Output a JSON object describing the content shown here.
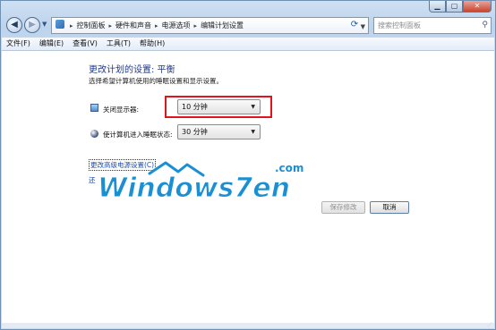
{
  "window": {
    "caption_buttons": {
      "minimize": "▁",
      "maximize": "▢",
      "close": "✕"
    }
  },
  "address_bar": {
    "icon": "control-panel-icon",
    "crumbs": [
      "控制面板",
      "硬件和声音",
      "电源选项",
      "编辑计划设置"
    ],
    "search_placeholder": "搜索控制面板"
  },
  "menu": {
    "items": [
      "文件(F)",
      "编辑(E)",
      "查看(V)",
      "工具(T)",
      "帮助(H)"
    ]
  },
  "content": {
    "title": "更改计划的设置: 平衡",
    "subtitle": "选择希望计算机使用的睡眠设置和显示设置。",
    "display_label": "关闭显示器:",
    "display_value": "10 分钟",
    "sleep_label": "使计算机进入睡眠状态:",
    "sleep_value": "30 分钟",
    "advanced_link": "更改高级电源设置(C)",
    "restore_link": "还",
    "save_button": "保存修改",
    "cancel_button": "取消"
  },
  "watermark": {
    "text": "Windows7en",
    "domain": ".com"
  },
  "colors": {
    "title": "#1e3a8c",
    "link": "#1a4fb1",
    "highlight": "#e0141a",
    "watermark": "#1b8fd4"
  }
}
